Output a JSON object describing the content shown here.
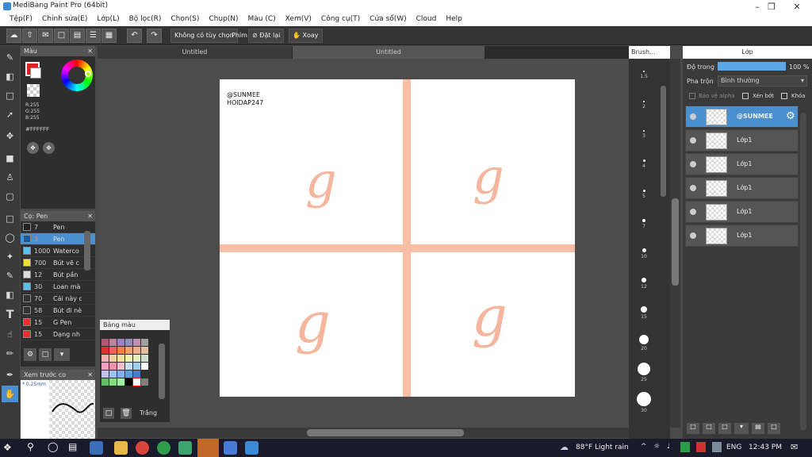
{
  "app": {
    "title": "MediBang Paint Pro (64bit)"
  },
  "menu": [
    "Tệp(F)",
    "Chỉnh sửa(E)",
    "Lớp(L)",
    "Bộ lọc(R)",
    "Chọn(S)",
    "Chụp(N)",
    "Màu (C)",
    "Xem(V)",
    "Công cụ(T)",
    "Cửa sổ(W)",
    "Cloud",
    "Help"
  ],
  "toolbar": {
    "dropdown": "Không có tùy chọn",
    "phim": "Phím",
    "reset": "Đặt lại",
    "rotate": "Xoay"
  },
  "color_panel": {
    "title": "Màu",
    "r": "R:255",
    "g": "G:255",
    "b": "B:255",
    "hex": "#FFFFFF"
  },
  "brush_panel": {
    "title": "Cọ: Pen",
    "items": [
      {
        "size": "7",
        "name": "Pen",
        "color": "#222222"
      },
      {
        "size": "3",
        "name": "Pen",
        "color": "#1e5a9a"
      },
      {
        "size": "1000",
        "name": "Waterco",
        "color": "#5bc0f0"
      },
      {
        "size": "700",
        "name": "Bút vẽ c",
        "color": "#f0e030"
      },
      {
        "size": "12",
        "name": "Bút pần",
        "color": "#dddddd"
      },
      {
        "size": "30",
        "name": "Loan mà",
        "color": "#5bc0f0"
      },
      {
        "size": "70",
        "name": "Cái này c",
        "color": "#333333"
      },
      {
        "size": "58",
        "name": "Bút đi nè",
        "color": "#333333"
      },
      {
        "size": "15",
        "name": "G Pen",
        "color": "#e83030"
      },
      {
        "size": "15",
        "name": "Dạng nh",
        "color": "#e83030"
      }
    ]
  },
  "preview_panel": {
    "title": "Xem trước co",
    "size": "0.25mm"
  },
  "palette": {
    "title": "Bảng màu",
    "selected": "Trắng",
    "colors": [
      "#b05878",
      "#c080a0",
      "#a080c0",
      "#9090c0",
      "#c090b0",
      "#a0a0a0",
      "#e03030",
      "#f06060",
      "#f08050",
      "#f0a070",
      "#f0b090",
      "#e0c0a0",
      "#f0b0b0",
      "#f0d0a0",
      "#f0e0a0",
      "#f0f0b0",
      "#e0f0c0",
      "#d0e0d0",
      "#f0a0c0",
      "#f090b0",
      "#f0c0d0",
      "#c0e0f0",
      "#a0d0f0",
      "#ffffff",
      "#c0c0f0",
      "#a0c0f0",
      "#80b0f0",
      "#60a0e0",
      "#4080d0",
      "#303030",
      "#60c060",
      "#80e080",
      "#a0f0a0",
      "#000000",
      "#ffffff",
      "#808080"
    ]
  },
  "tabs": [
    "Untitled",
    "Untitled"
  ],
  "canvas": {
    "watermark1": "@SUNMEE",
    "watermark2": "HOIDAP247",
    "glyph": "g"
  },
  "brush_sizes": {
    "title": "Brush...",
    "labels": [
      "1.5",
      "2",
      "3",
      "4",
      "5",
      "7",
      "10",
      "12",
      "15",
      "20",
      "25",
      "30"
    ]
  },
  "layer_panel": {
    "title": "Lớp",
    "opacity_label": "Độ trong",
    "opacity": "100 %",
    "opacity_value": 100,
    "blend_label": "Pha trộn",
    "blend": "Bình thường",
    "protect": "Bảo vệ alpha",
    "clip": "Xén bớt",
    "lock": "Khóa",
    "layers": [
      {
        "name": "@SUNMEE",
        "active": true
      },
      {
        "name": "Lớp1"
      },
      {
        "name": "Lớp1"
      },
      {
        "name": "Lớp1"
      },
      {
        "name": "Lớp1"
      },
      {
        "name": "Lớp1"
      }
    ]
  },
  "taskbar": {
    "weather": "88°F  Light rain",
    "lang": "ENG",
    "time": "12:43 PM"
  },
  "accent": "#4a8fd0"
}
